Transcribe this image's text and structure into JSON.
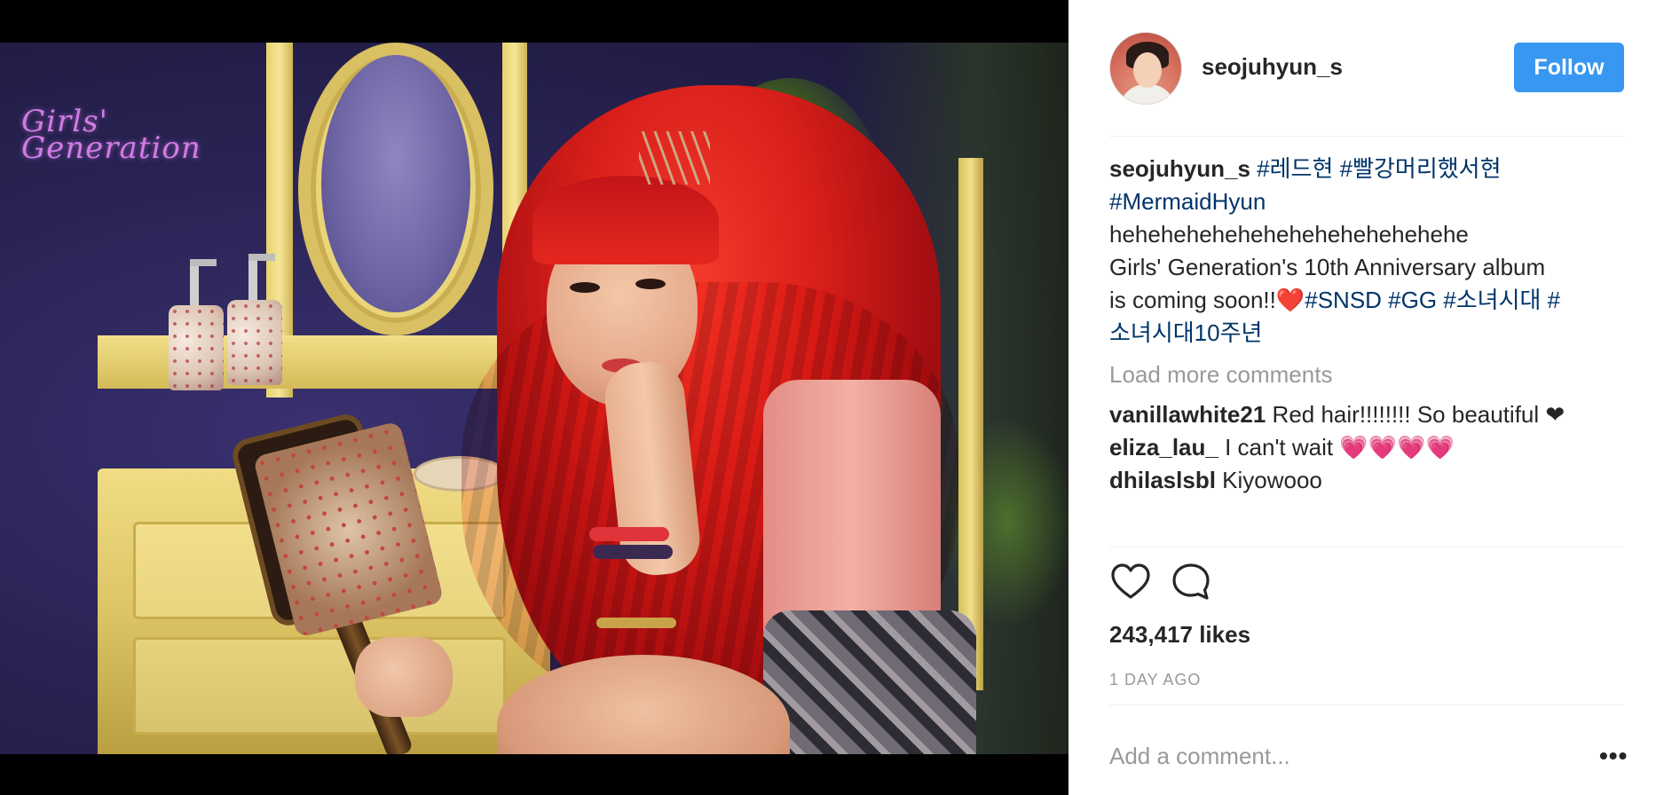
{
  "media": {
    "logo_line1": "Girls'",
    "logo_line2": "Generation"
  },
  "header": {
    "username": "seojuhyun_s",
    "follow_label": "Follow"
  },
  "caption": {
    "username": "seojuhyun_s",
    "tags_line1": "#레드현 #빨강머리했서현",
    "tag_line2": "#MermaidHyun",
    "text_line1": "hehehehehehehehehehehehehehe",
    "text_line2": "Girls' Generation's 10th Anniversary album",
    "text_line3": "is coming soon!!",
    "heart_emoji": "❤️",
    "tags_line3": "#SNSD #GG #소녀시대 #",
    "tags_line4": "소녀시대10주년"
  },
  "load_more_label": "Load more comments",
  "comments": [
    {
      "username": "vanillawhite21",
      "text": "Red hair!!!!!!!! So beautiful",
      "suffix": "❤"
    },
    {
      "username": "eliza_lau_",
      "text": "I can't wait",
      "suffix": "💗💗💗💗"
    },
    {
      "username": "dhilaslsbl",
      "text": "Kiyowooo",
      "suffix": ""
    }
  ],
  "actions": {
    "like_icon": "heart-outline-icon",
    "comment_icon": "speech-bubble-icon"
  },
  "likes": "243,417 likes",
  "timestamp": "1 DAY AGO",
  "comment_input": {
    "placeholder": "Add a comment..."
  },
  "more_label": "•••",
  "colors": {
    "follow_button": "#3897f0",
    "hashtag": "#003569",
    "muted": "#999999"
  }
}
